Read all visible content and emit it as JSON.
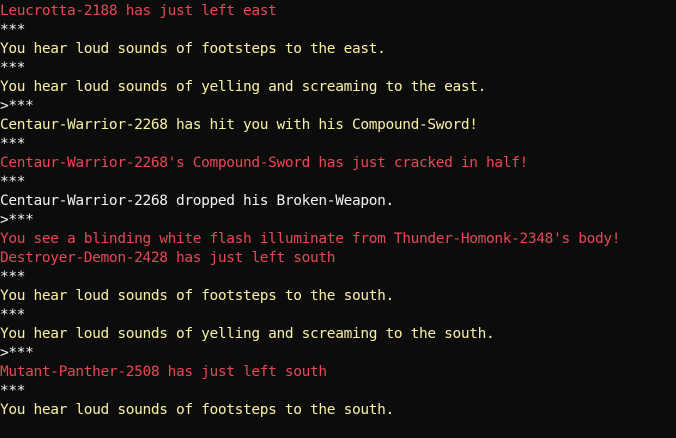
{
  "colors": {
    "background": "#0c0c0c",
    "red": "#e74856",
    "yellow": "#f9f1a5",
    "white": "#f2f2f2"
  },
  "lines": [
    {
      "text": "Leucrotta-2188 has just left east",
      "color": "red"
    },
    {
      "text": "***",
      "color": "white"
    },
    {
      "text": "You hear loud sounds of footsteps to the east.",
      "color": "yellow"
    },
    {
      "text": "***",
      "color": "white"
    },
    {
      "text": "You hear loud sounds of yelling and screaming to the east.",
      "color": "yellow"
    },
    {
      "text": ">***",
      "color": "white"
    },
    {
      "text": "Centaur-Warrior-2268 has hit you with his Compound-Sword!",
      "color": "yellow"
    },
    {
      "text": "***",
      "color": "white"
    },
    {
      "text": "Centaur-Warrior-2268's Compound-Sword has just cracked in half!",
      "color": "red"
    },
    {
      "text": "***",
      "color": "white"
    },
    {
      "text": "Centaur-Warrior-2268 dropped his Broken-Weapon.",
      "color": "white"
    },
    {
      "text": ">***",
      "color": "white"
    },
    {
      "text": "You see a blinding white flash illuminate from Thunder-Homonk-2348's body!",
      "color": "red"
    },
    {
      "text": "Destroyer-Demon-2428 has just left south",
      "color": "red"
    },
    {
      "text": "***",
      "color": "white"
    },
    {
      "text": "You hear loud sounds of footsteps to the south.",
      "color": "yellow"
    },
    {
      "text": "***",
      "color": "white"
    },
    {
      "text": "You hear loud sounds of yelling and screaming to the south.",
      "color": "yellow"
    },
    {
      "text": ">***",
      "color": "white"
    },
    {
      "text": "Mutant-Panther-2508 has just left south",
      "color": "red"
    },
    {
      "text": "***",
      "color": "white"
    },
    {
      "text": "You hear loud sounds of footsteps to the south.",
      "color": "yellow"
    }
  ]
}
